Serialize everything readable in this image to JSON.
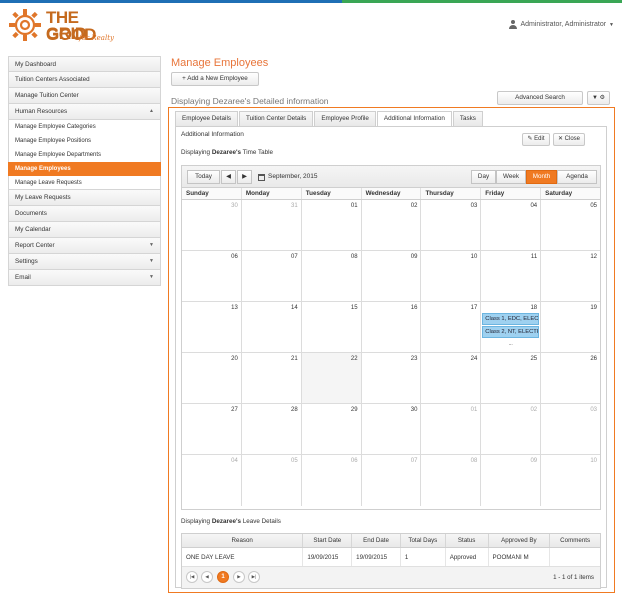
{
  "app": {
    "logo_line1": "THE GOOD",
    "logo_line2": "GRID",
    "logo_tagline": "for Realty",
    "user_label": "Administrator, Administrator"
  },
  "sidebar": {
    "items": [
      {
        "label": "My Dashboard"
      },
      {
        "label": "Tuition Centers Associated"
      },
      {
        "label": "Manage Tuition Center"
      },
      {
        "label": "Human Resources",
        "expanded": true
      }
    ],
    "hr_subitems": [
      {
        "label": "Manage Employee Categories"
      },
      {
        "label": "Manage Employee Positions"
      },
      {
        "label": "Manage Employee Departments"
      },
      {
        "label": "Manage Employees",
        "active": true
      },
      {
        "label": "Manage Leave Requests"
      }
    ],
    "items_after": [
      {
        "label": "My Leave Requests"
      },
      {
        "label": "Documents"
      },
      {
        "label": "My Calendar"
      },
      {
        "label": "Report Center"
      },
      {
        "label": "Settings"
      },
      {
        "label": "Email"
      }
    ]
  },
  "main": {
    "title": "Manage Employees",
    "add_button": "+ Add a New Employee",
    "subheading": "Displaying Dezaree's Detailed information",
    "advanced_search": "Advanced Search",
    "tabs": [
      {
        "label": "Employee Details"
      },
      {
        "label": "Tuition Center Details"
      },
      {
        "label": "Employee Profile"
      },
      {
        "label": "Additional Information",
        "active": true
      },
      {
        "label": "Tasks"
      }
    ],
    "section_title": "Additional Information",
    "edit_button": "Edit",
    "close_button": "Close",
    "timetable_prefix": "Displaying",
    "timetable_name": "Dezaree's",
    "timetable_suffix": "Time Table"
  },
  "calendar": {
    "today_label": "Today",
    "current_label": "September, 2015",
    "views": [
      "Day",
      "Week",
      "Month",
      "Agenda"
    ],
    "active_view": "Month",
    "weekdays": [
      "Sunday",
      "Monday",
      "Tuesday",
      "Wednesday",
      "Thursday",
      "Friday",
      "Saturday"
    ],
    "weeks": [
      [
        "30",
        "31",
        "01",
        "02",
        "03",
        "04",
        "05"
      ],
      [
        "06",
        "07",
        "08",
        "09",
        "10",
        "11",
        "12"
      ],
      [
        "13",
        "14",
        "15",
        "16",
        "17",
        "18",
        "19"
      ],
      [
        "20",
        "21",
        "22",
        "23",
        "24",
        "25",
        "26"
      ],
      [
        "27",
        "28",
        "29",
        "30",
        "01",
        "02",
        "03"
      ],
      [
        "04",
        "05",
        "06",
        "07",
        "08",
        "09",
        "10"
      ]
    ],
    "events": [
      {
        "week": 2,
        "day": 5,
        "label": "Class 1, EDC, ELECTRONICS EC"
      },
      {
        "week": 2,
        "day": 5,
        "label": "Class 2, NT, ELECTRONICS EC"
      }
    ],
    "more_indicator": "..."
  },
  "leave": {
    "prefix": "Displaying",
    "name": "Dezaree's",
    "suffix": "Leave Details",
    "columns": [
      "Reason",
      "Start Date",
      "End Date",
      "Total Days",
      "Status",
      "Approved By",
      "Comments"
    ],
    "rows": [
      [
        "ONE DAY LEAVE",
        "19/09/2015",
        "19/09/2015",
        "1",
        "Approved",
        "POOMANI M",
        ""
      ]
    ],
    "pager": {
      "current_page": "1",
      "info": "1 - 1 of 1 items"
    }
  }
}
